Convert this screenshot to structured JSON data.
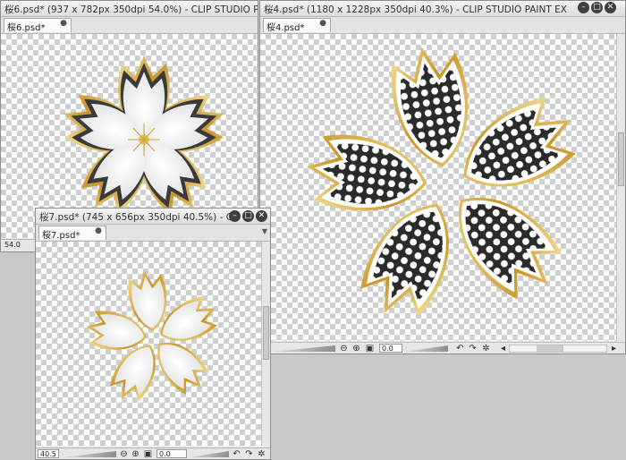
{
  "windows": {
    "sakura6": {
      "title": "桜6.psd* (937 x 782px 350dpi 54.0%) - CLIP STUDIO PA",
      "tab": "桜6.psd*",
      "zoom": "54.0"
    },
    "sakura4": {
      "title": "桜4.psd* (1180 x 1228px 350dpi 40.3%) - CLIP STUDIO PAINT EX",
      "tab": "桜4.psd*",
      "zoom": "3",
      "angle": "0.0"
    },
    "sakura7": {
      "title": "桜7.psd* (745 x 656px 350dpi 40.5%) - CL",
      "tab": "桜7.psd*",
      "zoom": "40.5",
      "angle": "0.0"
    }
  },
  "icons": {
    "minimize": "minimize-icon",
    "maximize": "maximize-icon",
    "close": "close-icon",
    "zoom_out": "zoom-out-icon",
    "zoom_in": "zoom-in-icon",
    "fit": "fit-view-icon",
    "rotate_left": "rotate-left-icon",
    "rotate_right": "rotate-right-icon",
    "reset": "reset-rotation-icon"
  },
  "colors": {
    "gold": "#d4a83a",
    "dark_petal": "#2b2b2b",
    "checker": "#cfcfcf"
  }
}
